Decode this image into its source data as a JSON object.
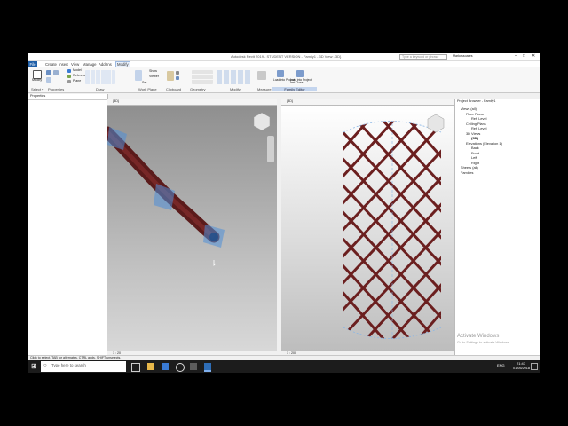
{
  "app": {
    "title": "Autodesk Revit 2019 - STUDENT VERSION - Family1 - 3D View: {3D}",
    "search_placeholder": "Type a keyword or phrase",
    "username": "Markussoares"
  },
  "menu": [
    "File",
    "Create",
    "Insert",
    "View",
    "Manage",
    "Add-Ins",
    "Modify"
  ],
  "ribbon": {
    "panels": [
      "Select ▾",
      "Properties",
      "Draw",
      "Work Plane",
      "Clipboard",
      "Geometry",
      "Modify",
      "Measure",
      "Family Editor"
    ],
    "modify_label": "Modify",
    "draw_items": [
      "Model",
      "Reference",
      "Plane"
    ],
    "work_plane_items": [
      "Show",
      "Set",
      "Viewer"
    ],
    "family_editor_items": [
      "Load into Project",
      "Load into Project and Close"
    ]
  },
  "properties": {
    "title": "Properties"
  },
  "views": {
    "left_tab": "{3D}",
    "right_tab": "{3D}",
    "left_scale": "1 : 20",
    "right_scale": "1 : 200"
  },
  "browser": {
    "title": "Project Browser - Family1",
    "items": [
      "Views (all)",
      "Floor Plans",
      "Ref. Level",
      "Ceiling Plans",
      "Ref. Level",
      "3D Views",
      "{3D}",
      "Elevations (Elevation 1)",
      "Back",
      "Front",
      "Left",
      "Right",
      "Sheets (all)",
      "Families"
    ]
  },
  "status": {
    "text": "Click to select, TAB for alternates, CTRL adds, SHIFT unselects."
  },
  "watermark": {
    "line1": "Activate Windows",
    "line2": "Go to Settings to activate Windows."
  },
  "taskbar": {
    "search_placeholder": "Type here to search",
    "time": "21:47",
    "date": "01/05/2018",
    "lang": "ENG"
  },
  "colors": {
    "rebar": "#6b1f1f",
    "accent": "#1f5fa8"
  }
}
